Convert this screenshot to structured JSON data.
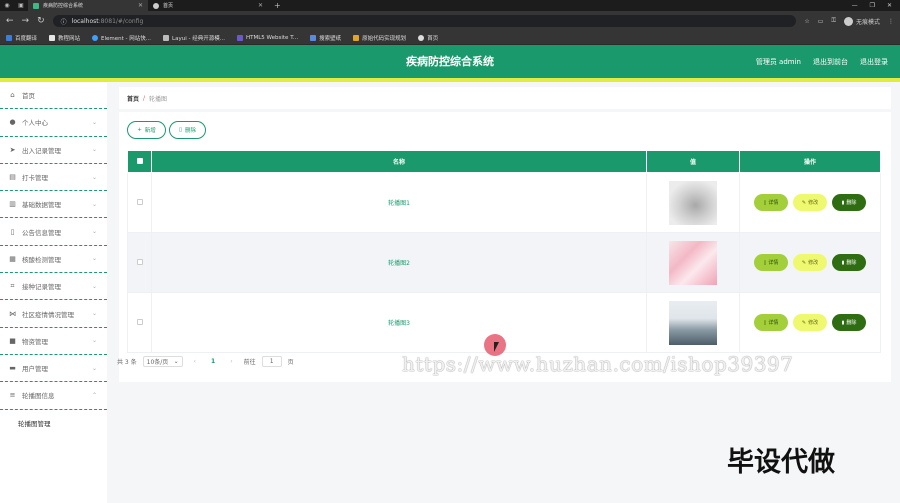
{
  "browser": {
    "tabs": [
      {
        "title": "疾病防控综合系统",
        "active": true
      },
      {
        "title": "首页",
        "active": false
      }
    ],
    "url_host": "localhost",
    "url_path": ":8081/#/config",
    "profile_label": "无痕模式",
    "bookmarks": [
      "百度翻译",
      "教程网站",
      "Element - 网站快...",
      "Layui - 经典开源模...",
      "HTML5 Website T...",
      "搜索壁纸",
      "原始代码实现规划",
      "首页"
    ]
  },
  "header": {
    "title": "疾病防控综合系统",
    "admin_label": "管理员 admin",
    "exit_to_front": "退出到前台",
    "logout": "退出登录"
  },
  "sidebar": {
    "items": [
      {
        "label": "首页",
        "icon": "home-icon"
      },
      {
        "label": "个人中心",
        "icon": "user-icon"
      },
      {
        "label": "出入记录管理",
        "icon": "send-icon"
      },
      {
        "label": "打卡管理",
        "icon": "printer-icon"
      },
      {
        "label": "基础数据管理",
        "icon": "trash-icon"
      },
      {
        "label": "公告信息管理",
        "icon": "document-icon"
      },
      {
        "label": "核酸检测管理",
        "icon": "chart-icon"
      },
      {
        "label": "接种记录管理",
        "icon": "crop-icon"
      },
      {
        "label": "社区疫情情况管理",
        "icon": "share-icon"
      },
      {
        "label": "物资管理",
        "icon": "box-icon"
      },
      {
        "label": "用户管理",
        "icon": "folder-icon"
      },
      {
        "label": "轮播图信息",
        "icon": "settings-icon"
      }
    ],
    "sub_item": "轮播图管理"
  },
  "breadcrumb": {
    "home": "首页",
    "separator": "/",
    "current": "轮播图"
  },
  "toolbar": {
    "add_label": "新增",
    "delete_label": "删除"
  },
  "table": {
    "headers": [
      "名称",
      "值",
      "操作"
    ],
    "rows": [
      {
        "name": "轮播图1"
      },
      {
        "name": "轮播图2"
      },
      {
        "name": "轮播图3"
      }
    ],
    "actions": {
      "detail": "详情",
      "edit": "修改",
      "delete": "删除"
    }
  },
  "pager": {
    "total": "共 3 条",
    "page_size": "10条/页",
    "current_page": "1",
    "goto_prefix": "前往",
    "goto_value": "1",
    "goto_suffix": "页"
  },
  "overlays": {
    "watermark": "https://www.huzhan.com/ishop39397",
    "stamp": "毕设代做"
  },
  "colors": {
    "primary": "#1a9a6c",
    "accent_bar": "#e2ec3e",
    "detail_btn": "#a2cf3a",
    "edit_btn": "#eef96f",
    "delete_btn": "#2f6d13"
  }
}
